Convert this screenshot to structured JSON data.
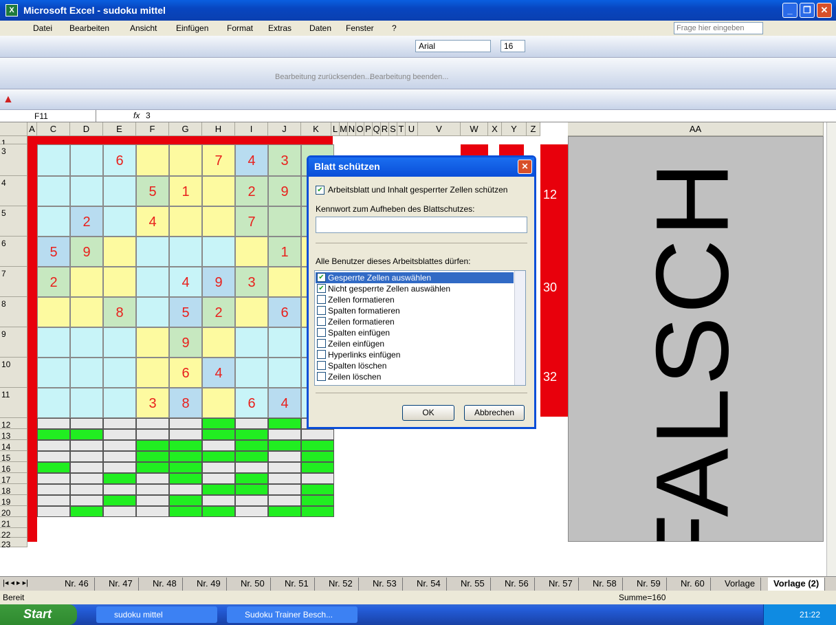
{
  "window": {
    "title": "Microsoft Excel - sudoku mittel"
  },
  "menu": [
    "Datei",
    "Bearbeiten",
    "Ansicht",
    "Einfügen",
    "Format",
    "Extras",
    "Daten",
    "Fenster",
    "?"
  ],
  "help_placeholder": "Frage hier eingeben",
  "toolbar": {
    "font": "Arial",
    "size": "16",
    "review_back": "Bearbeitung zurücksenden...",
    "review_end": "Bearbeitung beenden..."
  },
  "namebox": "F11",
  "formula": "3",
  "fx": "fx",
  "columns": [
    "A",
    "C",
    "D",
    "E",
    "F",
    "G",
    "H",
    "I",
    "J",
    "K",
    "L",
    "M",
    "N",
    "O",
    "P",
    "Q",
    "R",
    "S",
    "T",
    "U",
    "V",
    "W",
    "X",
    "Y",
    "Z",
    "AA"
  ],
  "rows": [
    "1",
    "3",
    "4",
    "5",
    "6",
    "7",
    "8",
    "9",
    "10",
    "11",
    "12",
    "13",
    "14",
    "15",
    "16",
    "17",
    "18",
    "19",
    "20",
    "21",
    "22",
    "23"
  ],
  "sudoku": [
    [
      "",
      "",
      "6",
      "",
      "",
      "7",
      "4",
      "3",
      ""
    ],
    [
      "",
      "",
      "",
      "5",
      "1",
      "",
      "2",
      "9",
      ""
    ],
    [
      "",
      "2",
      "",
      "4",
      "",
      "",
      "7",
      "",
      ""
    ],
    [
      "5",
      "9",
      "",
      "",
      "",
      "",
      "",
      "1",
      ""
    ],
    [
      "2",
      "",
      "",
      "",
      "4",
      "9",
      "3",
      "",
      ""
    ],
    [
      "",
      "",
      "8",
      "",
      "5",
      "2",
      "",
      "6",
      ""
    ],
    [
      "",
      "",
      "",
      "",
      "9",
      "",
      "",
      "",
      ""
    ],
    [
      "",
      "",
      "",
      "",
      "6",
      "4",
      "",
      "",
      ""
    ],
    [
      "",
      "",
      "",
      "3",
      "8",
      "",
      "6",
      "4",
      ""
    ]
  ],
  "sums": [
    "12",
    "30",
    "32"
  ],
  "verdict": "FALSCH",
  "dialog": {
    "title": "Blatt schützen",
    "protect_label": "Arbeitsblatt und Inhalt gesperrter Zellen schützen",
    "pw_label": "Kennwort zum Aufheben des Blattschutzes:",
    "allow_label": "Alle Benutzer dieses Arbeitsblattes dürfen:",
    "options": [
      {
        "label": "Gesperrte Zellen auswählen",
        "checked": true
      },
      {
        "label": "Nicht gesperrte Zellen auswählen",
        "checked": true
      },
      {
        "label": "Zellen formatieren",
        "checked": false
      },
      {
        "label": "Spalten formatieren",
        "checked": false
      },
      {
        "label": "Zeilen formatieren",
        "checked": false
      },
      {
        "label": "Spalten einfügen",
        "checked": false
      },
      {
        "label": "Zeilen einfügen",
        "checked": false
      },
      {
        "label": "Hyperlinks einfügen",
        "checked": false
      },
      {
        "label": "Spalten löschen",
        "checked": false
      },
      {
        "label": "Zeilen löschen",
        "checked": false
      }
    ],
    "ok": "OK",
    "cancel": "Abbrechen"
  },
  "tabs": [
    "Nr. 46",
    "Nr. 47",
    "Nr. 48",
    "Nr. 49",
    "Nr. 50",
    "Nr. 51",
    "Nr. 52",
    "Nr. 53",
    "Nr. 54",
    "Nr. 55",
    "Nr. 56",
    "Nr. 57",
    "Nr. 58",
    "Nr. 59",
    "Nr. 60",
    "Vorlage",
    "Vorlage (2)"
  ],
  "status": {
    "left": "Bereit",
    "sum": "Summe=160"
  },
  "taskbar": {
    "start": "Start",
    "task1": "sudoku mittel",
    "task2": "Sudoku Trainer Besch...",
    "clock": "21:22"
  }
}
